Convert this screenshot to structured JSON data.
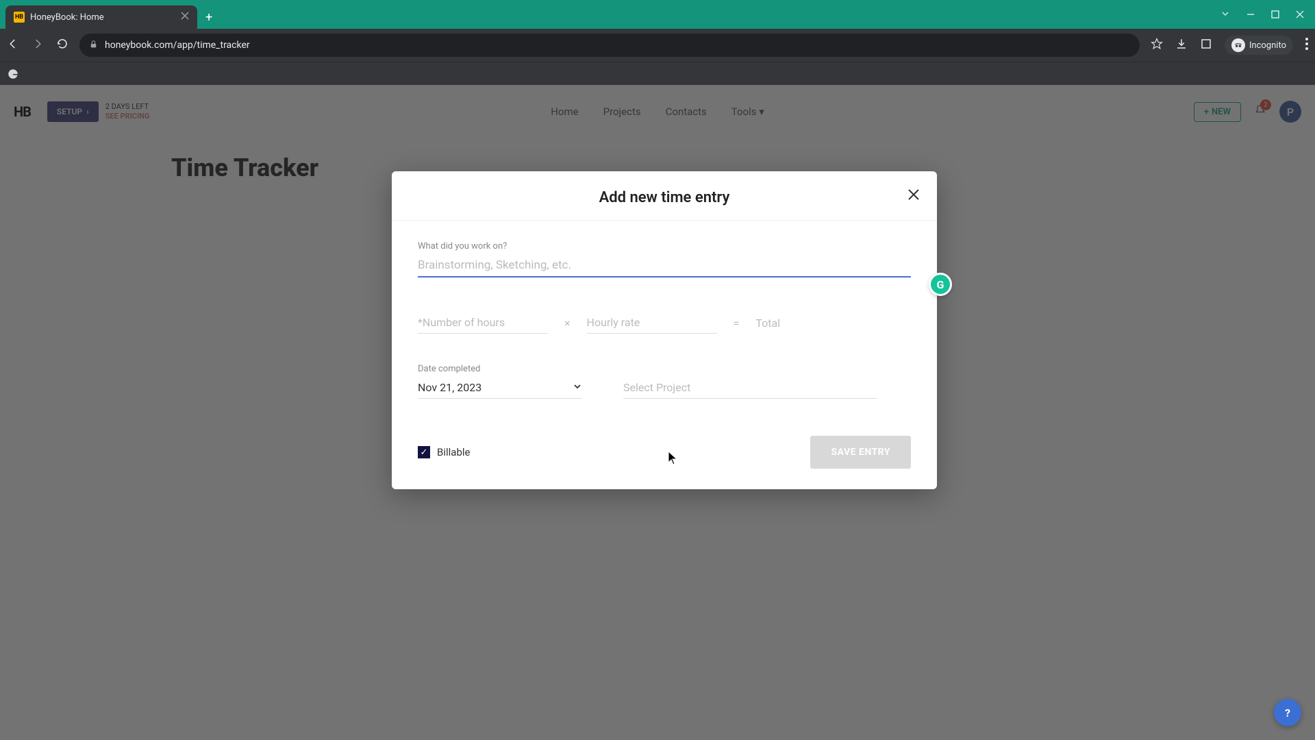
{
  "browser": {
    "tab_title": "HoneyBook: Home",
    "url": "honeybook.com/app/time_tracker",
    "incognito_label": "Incognito"
  },
  "header": {
    "logo": "HB",
    "setup_label": "SETUP",
    "trial_line1": "2 DAYS LEFT",
    "trial_line2": "SEE PRICING",
    "nav": [
      "Home",
      "Projects",
      "Contacts",
      "Tools"
    ],
    "new_button": "NEW",
    "notification_count": "2",
    "avatar_initial": "P"
  },
  "page": {
    "title": "Time Tracker"
  },
  "modal": {
    "title": "Add new time entry",
    "work_label": "What did you work on?",
    "work_placeholder": "Brainstorming, Sketching, etc.",
    "hours_placeholder": "*Number of hours",
    "rate_placeholder": "Hourly rate",
    "total_label": "Total",
    "date_label": "Date completed",
    "date_value": "Nov 21, 2023",
    "project_placeholder": "Select Project",
    "billable_label": "Billable",
    "billable_checked": true,
    "save_label": "SAVE ENTRY"
  },
  "help": "?"
}
